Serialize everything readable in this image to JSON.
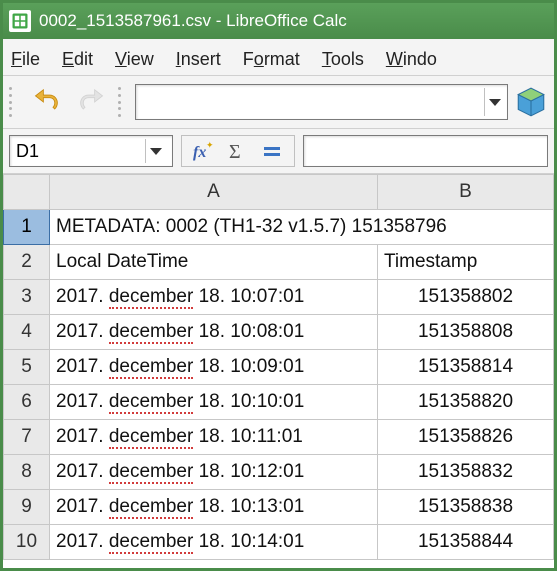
{
  "window": {
    "title": "0002_1513587961.csv - LibreOffice Calc"
  },
  "menu": {
    "file": {
      "mn": "F",
      "rest": "ile"
    },
    "edit": {
      "mn": "E",
      "rest": "dit"
    },
    "view": {
      "mn": "V",
      "rest": "iew"
    },
    "insert": {
      "mn": "I",
      "rest": "nsert"
    },
    "format": {
      "pre": "F",
      "mn": "o",
      "rest": "rmat"
    },
    "tools": {
      "mn": "T",
      "rest": "ools"
    },
    "window": {
      "mn": "W",
      "rest": "indo"
    }
  },
  "namebox": {
    "value": "D1"
  },
  "colhdr": {
    "A": "A",
    "B": "B"
  },
  "rows": [
    {
      "n": "1",
      "A": "METADATA: 0002 (TH1-32 v1.5.7) 151358796",
      "B": ""
    },
    {
      "n": "2",
      "A": "Local DateTime",
      "B": "Timestamp"
    },
    {
      "n": "3",
      "A_pre": "2017. ",
      "A_err": "december",
      "A_post": " 18. 10:07:01",
      "B": "151358802"
    },
    {
      "n": "4",
      "A_pre": "2017. ",
      "A_err": "december",
      "A_post": " 18. 10:08:01",
      "B": "151358808"
    },
    {
      "n": "5",
      "A_pre": "2017. ",
      "A_err": "december",
      "A_post": " 18. 10:09:01",
      "B": "151358814"
    },
    {
      "n": "6",
      "A_pre": "2017. ",
      "A_err": "december",
      "A_post": " 18. 10:10:01",
      "B": "151358820"
    },
    {
      "n": "7",
      "A_pre": "2017. ",
      "A_err": "december",
      "A_post": " 18. 10:11:01",
      "B": "151358826"
    },
    {
      "n": "8",
      "A_pre": "2017. ",
      "A_err": "december",
      "A_post": " 18. 10:12:01",
      "B": "151358832"
    },
    {
      "n": "9",
      "A_pre": "2017. ",
      "A_err": "december",
      "A_post": " 18. 10:13:01",
      "B": "151358838"
    },
    {
      "n": "10",
      "A_pre": "2017. ",
      "A_err": "december",
      "A_post": " 18. 10:14:01",
      "B": "151358844"
    }
  ]
}
